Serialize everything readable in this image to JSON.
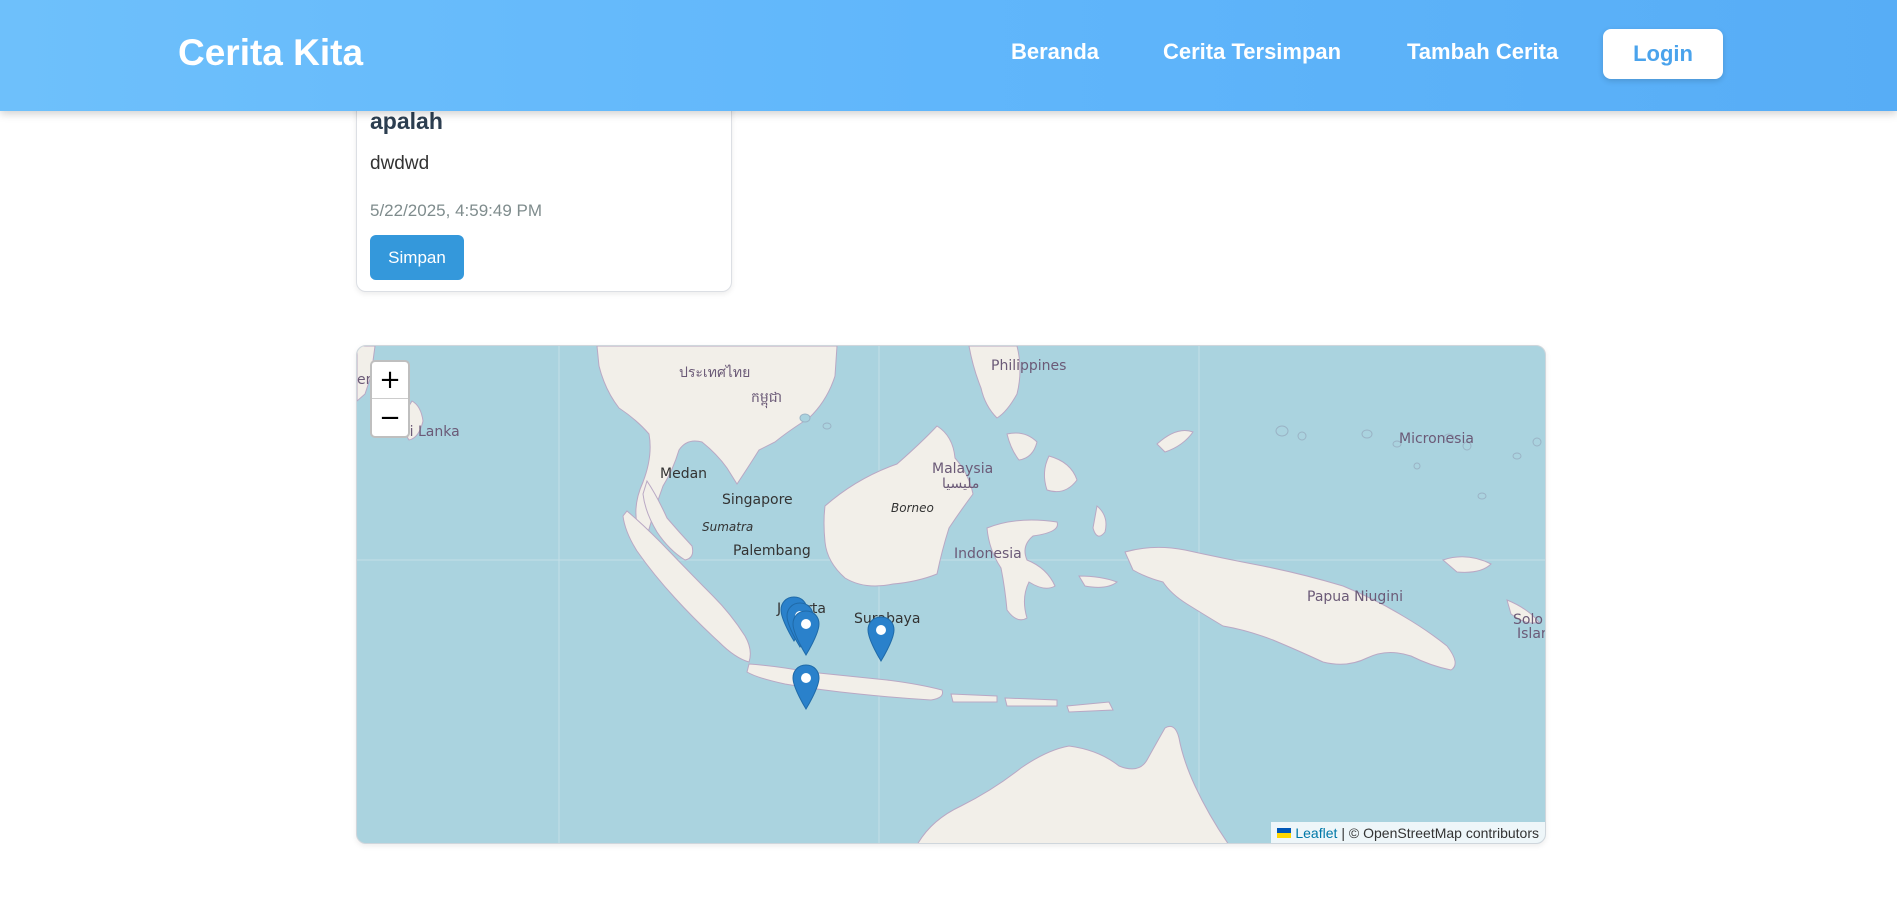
{
  "header": {
    "brand": "Cerita Kita",
    "nav": [
      "Beranda",
      "Cerita Tersimpan",
      "Tambah Cerita"
    ],
    "login_label": "Login"
  },
  "story": {
    "title": "apalah",
    "description": "dwdwd",
    "date": "5/22/2025, 4:59:49 PM",
    "save_label": "Simpan"
  },
  "map": {
    "zoom_in": "+",
    "zoom_out": "−",
    "labels": {
      "philippines": "Philippines",
      "thailand": "ประเทศไทย",
      "cambodia": "កម្ពុជា",
      "sri_lanka": "Sri Lanka",
      "micronesia": "Micronesia",
      "medan": "Medan",
      "malaysia": "Malaysia",
      "malaysia_jawi": "مليسيا",
      "singapore": "Singapore",
      "borneo": "Borneo",
      "sumatra": "Sumatra",
      "palembang": "Palembang",
      "indonesia": "Indonesia",
      "papua": "Papua Niugini",
      "jakarta": "Jakarta",
      "surabaya": "Surabaya",
      "solomon_1": "Solo",
      "solomon_2": "Islar",
      "edge_left": "er"
    },
    "attribution": {
      "leaflet": "Leaflet",
      "rest": "| © OpenStreetMap contributors"
    },
    "marker_count": 5
  }
}
